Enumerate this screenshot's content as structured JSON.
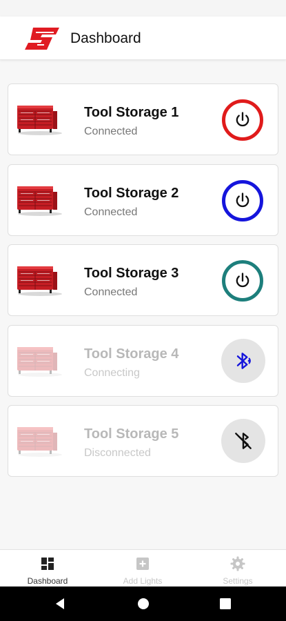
{
  "app": {
    "title": "Dashboard",
    "brand_color": "#e01b22"
  },
  "devices": [
    {
      "name": "Tool Storage 1",
      "status": "Connected",
      "button": "power",
      "ring_color": "#e01b1b",
      "icon": "power-icon"
    },
    {
      "name": "Tool Storage 2",
      "status": "Connected",
      "button": "power",
      "ring_color": "#1515dc",
      "icon": "power-icon"
    },
    {
      "name": "Tool Storage 3",
      "status": "Connected",
      "button": "power",
      "ring_color": "#1d7f7c",
      "icon": "power-icon"
    },
    {
      "name": "Tool Storage 4",
      "status": "Connecting",
      "button": "bluetooth-searching",
      "icon_color": "#1515dc",
      "icon": "bluetooth-searching-icon"
    },
    {
      "name": "Tool Storage 5",
      "status": "Disconnected",
      "button": "bluetooth-disabled",
      "icon_color": "#111111",
      "icon": "bluetooth-disabled-icon"
    }
  ],
  "bottom_nav": [
    {
      "label": "Dashboard",
      "icon": "dashboard-icon",
      "active": true
    },
    {
      "label": "Add Lights",
      "icon": "add-box-icon",
      "active": false
    },
    {
      "label": "Settings",
      "icon": "gear-icon",
      "active": false
    }
  ],
  "system_nav": [
    "back-icon",
    "home-icon",
    "recents-icon"
  ]
}
